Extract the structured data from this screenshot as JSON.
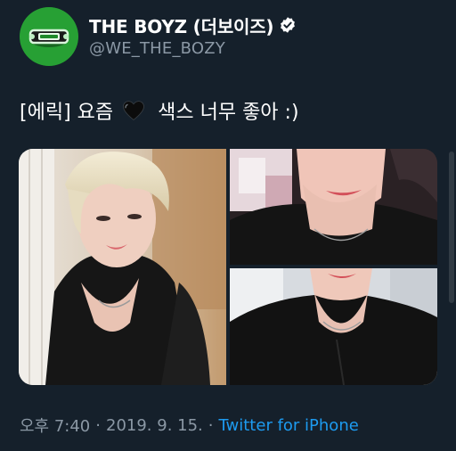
{
  "profile": {
    "display_name": "THE BOYZ (더보이즈)",
    "handle": "@WE_THE_BOZY",
    "verified": true,
    "avatar_icon": "bracelet-avatar"
  },
  "tweet": {
    "text_before": "[에릭] 요즘",
    "emoji_icon": "black-heart-icon",
    "text_after": "색스 너무 좋아 :)"
  },
  "media": {
    "photos": [
      {
        "name": "photo-1"
      },
      {
        "name": "photo-2"
      },
      {
        "name": "photo-3"
      }
    ]
  },
  "meta": {
    "time": "오후 7:40",
    "separator": "·",
    "date": "2019. 9. 15.",
    "separator2": "·",
    "source": "Twitter for iPhone"
  },
  "colors": {
    "background": "#15202b",
    "secondary_text": "#8b98a5",
    "link": "#1d9bf0",
    "verified_badge": "#ffffff"
  }
}
